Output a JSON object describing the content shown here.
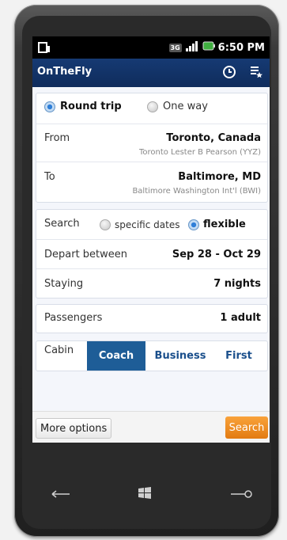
{
  "status": {
    "time": "6:50 PM",
    "network": "3G"
  },
  "app": {
    "title": "OnTheFly"
  },
  "trip": {
    "round_trip_label": "Round trip",
    "one_way_label": "One way",
    "from_label": "From",
    "from_city": "Toronto, Canada",
    "from_airport": "Toronto Lester B Pearson (YYZ)",
    "to_label": "To",
    "to_city": "Baltimore, MD",
    "to_airport": "Baltimore Washington Int'l (BWI)"
  },
  "search": {
    "label": "Search",
    "specific_label": "specific dates",
    "flexible_label": "flexible",
    "depart_label": "Depart between",
    "depart_value": "Sep 28 - Oct 29",
    "staying_label": "Staying",
    "staying_value": "7 nights"
  },
  "passengers": {
    "label": "Passengers",
    "value": "1 adult"
  },
  "cabin": {
    "label": "Cabin",
    "options": [
      "Coach",
      "Business",
      "First"
    ]
  },
  "actions": {
    "more_label": "More options",
    "search_label": "Search"
  },
  "colors": {
    "appbar": "#0f2c5c",
    "accent": "#1e5d97",
    "search": "#e27b12"
  }
}
